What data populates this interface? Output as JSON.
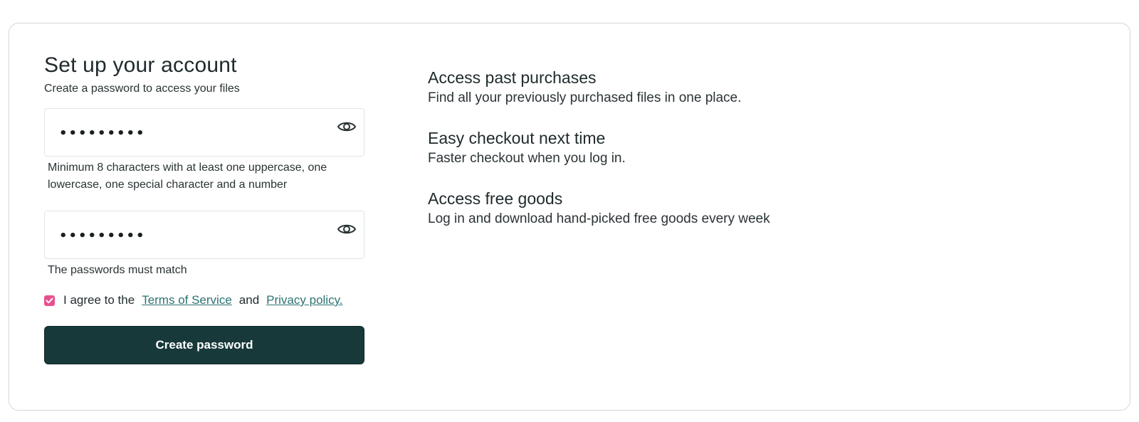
{
  "form": {
    "title": "Set up your account",
    "subtitle": "Create a password to access your files",
    "password_value": "•••••••••",
    "password_hint": "Minimum 8 characters with at least one uppercase, one lowercase, one special character and a number",
    "confirm_value": "•••••••••",
    "confirm_hint": "The passwords must match",
    "agree_prefix": "I agree to the",
    "terms_link": "Terms of Service",
    "agree_and": "and",
    "privacy_link": "Privacy policy.",
    "agree_checked": true,
    "submit_label": "Create password",
    "icons": {
      "show_password": "eye-icon",
      "checkbox": "check-icon"
    },
    "colors": {
      "submit_bg": "#17393a",
      "checkbox": "#e8518f",
      "link": "#2b7371"
    }
  },
  "benefits": [
    {
      "title": "Access past purchases",
      "description": "Find all your previously purchased files in one place."
    },
    {
      "title": "Easy checkout next time",
      "description": "Faster checkout when you log in."
    },
    {
      "title": "Access free goods",
      "description": "Log in and download hand-picked free goods every week"
    }
  ]
}
